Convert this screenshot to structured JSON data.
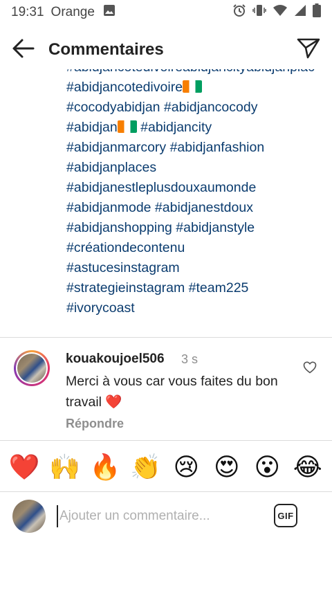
{
  "status_bar": {
    "time": "19:31",
    "carrier": "Orange",
    "icons": [
      "image-icon",
      "alarm-icon",
      "vibrate-icon",
      "wifi-icon",
      "signal-icon",
      "battery-icon"
    ]
  },
  "header": {
    "title": "Commentaires",
    "back_icon": "arrow-left-icon",
    "share_icon": "send-icon"
  },
  "caption": {
    "partial_line": "#abidjancotedivoireabidjancityabidjanplaces",
    "lines": [
      {
        "text": "#abidjancotedivoire",
        "flag": true
      },
      {
        "text": "#cocodyabidjan #abidjancocody"
      },
      {
        "text": "#abidjan",
        "flag_inline": true,
        "after": " #abidjancity"
      },
      {
        "text": "#abidjanmarcory #abidjanfashion"
      },
      {
        "text": "#abidjanplaces"
      },
      {
        "text": "#abidjanestleplusdouxaumonde"
      },
      {
        "text": "#abidjanmode #abidjanestdoux"
      },
      {
        "text": "#abidjanshopping #abidjanstyle"
      },
      {
        "text": "#créationdecontenu"
      },
      {
        "text": "#astucesinstagram"
      },
      {
        "text": "#strategieinstagram #team225"
      },
      {
        "text": "#ivorycoast"
      }
    ]
  },
  "comment": {
    "username": "kouakoujoel506",
    "time": "3 s",
    "text": "Merci à vous car vous faites du bon travail ❤️",
    "reply_label": "Répondre",
    "like_icon": "heart-outline-icon"
  },
  "quick_reactions": [
    "❤️",
    "🙌",
    "🔥",
    "👏",
    "😢",
    "😍",
    "😮",
    "😂"
  ],
  "composer": {
    "placeholder": "Ajouter un commentaire...",
    "value": "",
    "gif_label": "GIF"
  },
  "colors": {
    "hashtag": "#0b3c6f",
    "muted": "#8e8e8e",
    "divider": "#dbdbdb",
    "flag": [
      "#f77f00",
      "#ffffff",
      "#009e60"
    ]
  }
}
